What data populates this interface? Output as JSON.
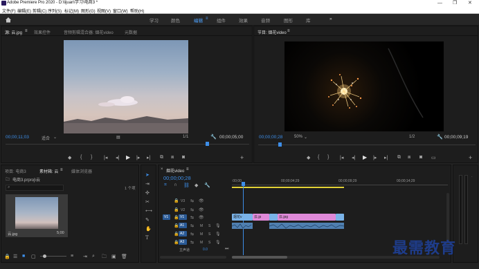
{
  "window": {
    "title": "Adobe Premiere Pro 2020 - D:\\lijuan\\学习\\电商3 *",
    "controls": [
      "—",
      "❐",
      "✕"
    ]
  },
  "menu": [
    "文件(F)",
    "编辑(E)",
    "剪辑(C)",
    "序列(S)",
    "标记(M)",
    "图形(G)",
    "视图(V)",
    "窗口(W)",
    "帮助(H)"
  ],
  "workspaces": {
    "items": [
      "学习",
      "颜色",
      "编辑",
      "组件",
      "效果",
      "音频",
      "图形",
      "库"
    ],
    "active": "编辑",
    "more": "»"
  },
  "source_panel": {
    "tabs": [
      "源: 云.jpg",
      "效果控件",
      "音频剪辑混合器: 烟花video",
      "元数据"
    ],
    "timecode": "00;00;11;03",
    "fit": "适合",
    "ratio": "1/1",
    "duration": "00;00;05;00"
  },
  "program_panel": {
    "tab": "节目: 烟花video",
    "timecode": "00;00;00;28",
    "fit": "50%",
    "ratio": "1/2",
    "duration": "00;00;09;19"
  },
  "project_panel": {
    "tabs": [
      "项目: 电商3",
      "素材箱: 云",
      "媒体浏览器"
    ],
    "path": "电商3.prproj\\云",
    "count": "1 个项",
    "item_name": "云.jpg",
    "item_duration": "5;00"
  },
  "timeline": {
    "tab": "烟花video",
    "timecode": "00;00;00;28",
    "ruler": [
      ":00;00",
      "00;00;04;29",
      "00;00;09;29",
      "00;00;14;29"
    ],
    "video_tracks": [
      "V3",
      "V2",
      "V1"
    ],
    "audio_tracks": [
      "A1",
      "A2",
      "A3"
    ],
    "master": "主声道",
    "master_value": "0.0",
    "clips": {
      "v1_a": "烟花v",
      "v1_b": "云.jp",
      "v1_c": "云.jpg"
    }
  },
  "watermark": "最需教育",
  "colors": {
    "accent": "#3d8ee8",
    "video_clip": "#df89d8",
    "video_clip_b": "#7ab3e8",
    "audio_clip": "#4f7fb0",
    "work_area": "#e2d136"
  }
}
